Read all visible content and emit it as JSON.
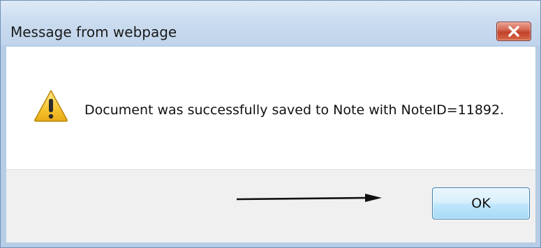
{
  "dialog": {
    "title": "Message from webpage",
    "message": "Document was successfully saved to Note with NoteID=11892.",
    "ok_label": "OK",
    "icons": {
      "close": "close-icon",
      "warning": "warning-icon",
      "arrow": "arrow-right-annotation"
    }
  },
  "colors": {
    "title_bar": "#c6d8ee",
    "close_button": "#c94a32",
    "content_background": "#ffffff",
    "button_area_background": "#f0f0f0",
    "ok_button": "#cdeafb",
    "warning_fill": "#f7c531"
  }
}
